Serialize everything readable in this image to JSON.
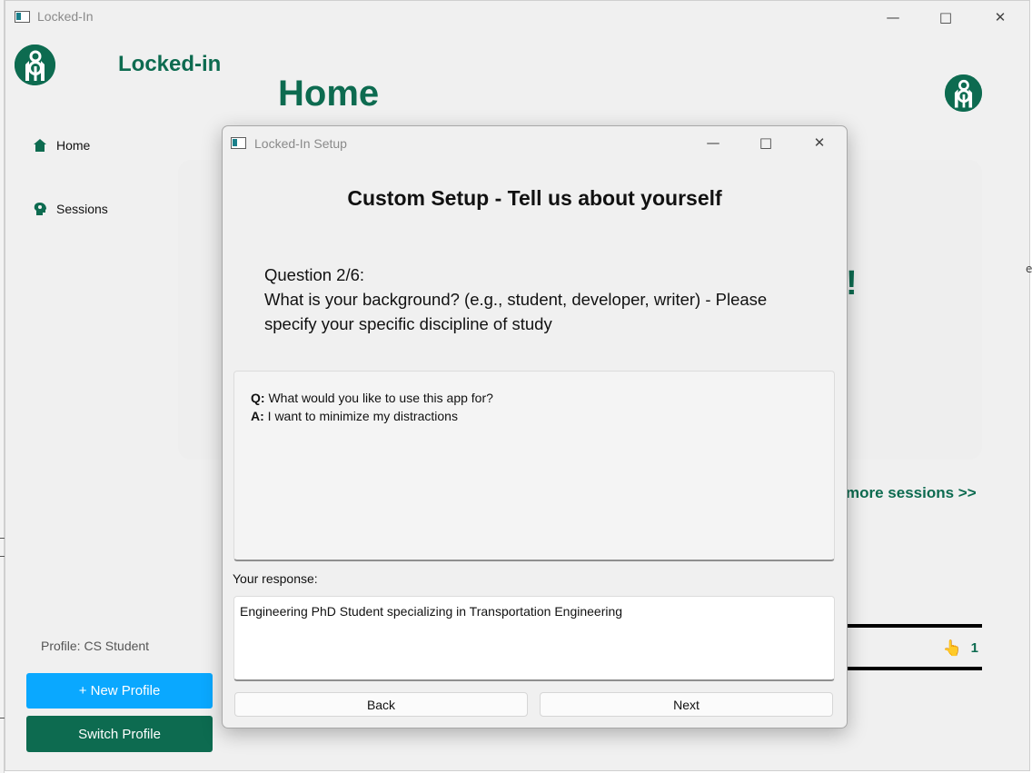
{
  "main_window": {
    "title": "Locked-In",
    "brand": "Locked-in",
    "page_title": "Home",
    "nav": [
      {
        "label": "Home",
        "icon": "home-icon"
      },
      {
        "label": "Sessions",
        "icon": "brain-icon"
      }
    ],
    "profile_label": "Profile: CS Student",
    "new_profile_button": "+ New Profile",
    "switch_profile_button": "Switch Profile",
    "background_fragments": {
      "exclaim": "!",
      "more_sessions": "more sessions >>",
      "count": "1",
      "edge_glyph": "e"
    }
  },
  "dialog": {
    "title": "Locked-In Setup",
    "heading": "Custom Setup - Tell us about yourself",
    "question_number": "Question 2/6:",
    "question_text": "What is your background? (e.g., student, developer, writer) - Please specify your specific discipline of study",
    "history": [
      {
        "q_label": "Q:",
        "q": "What would you like to use this app for?",
        "a_label": "A:",
        "a": "I want to minimize my distractions"
      }
    ],
    "response_label": "Your response:",
    "response_value": "Engineering PhD Student specializing in Transportation Engineering",
    "back_button": "Back",
    "next_button": "Next"
  },
  "colors": {
    "brand_green": "#0d6b50",
    "accent_blue": "#0aa8ff",
    "window_bg": "#f0f0f0"
  }
}
